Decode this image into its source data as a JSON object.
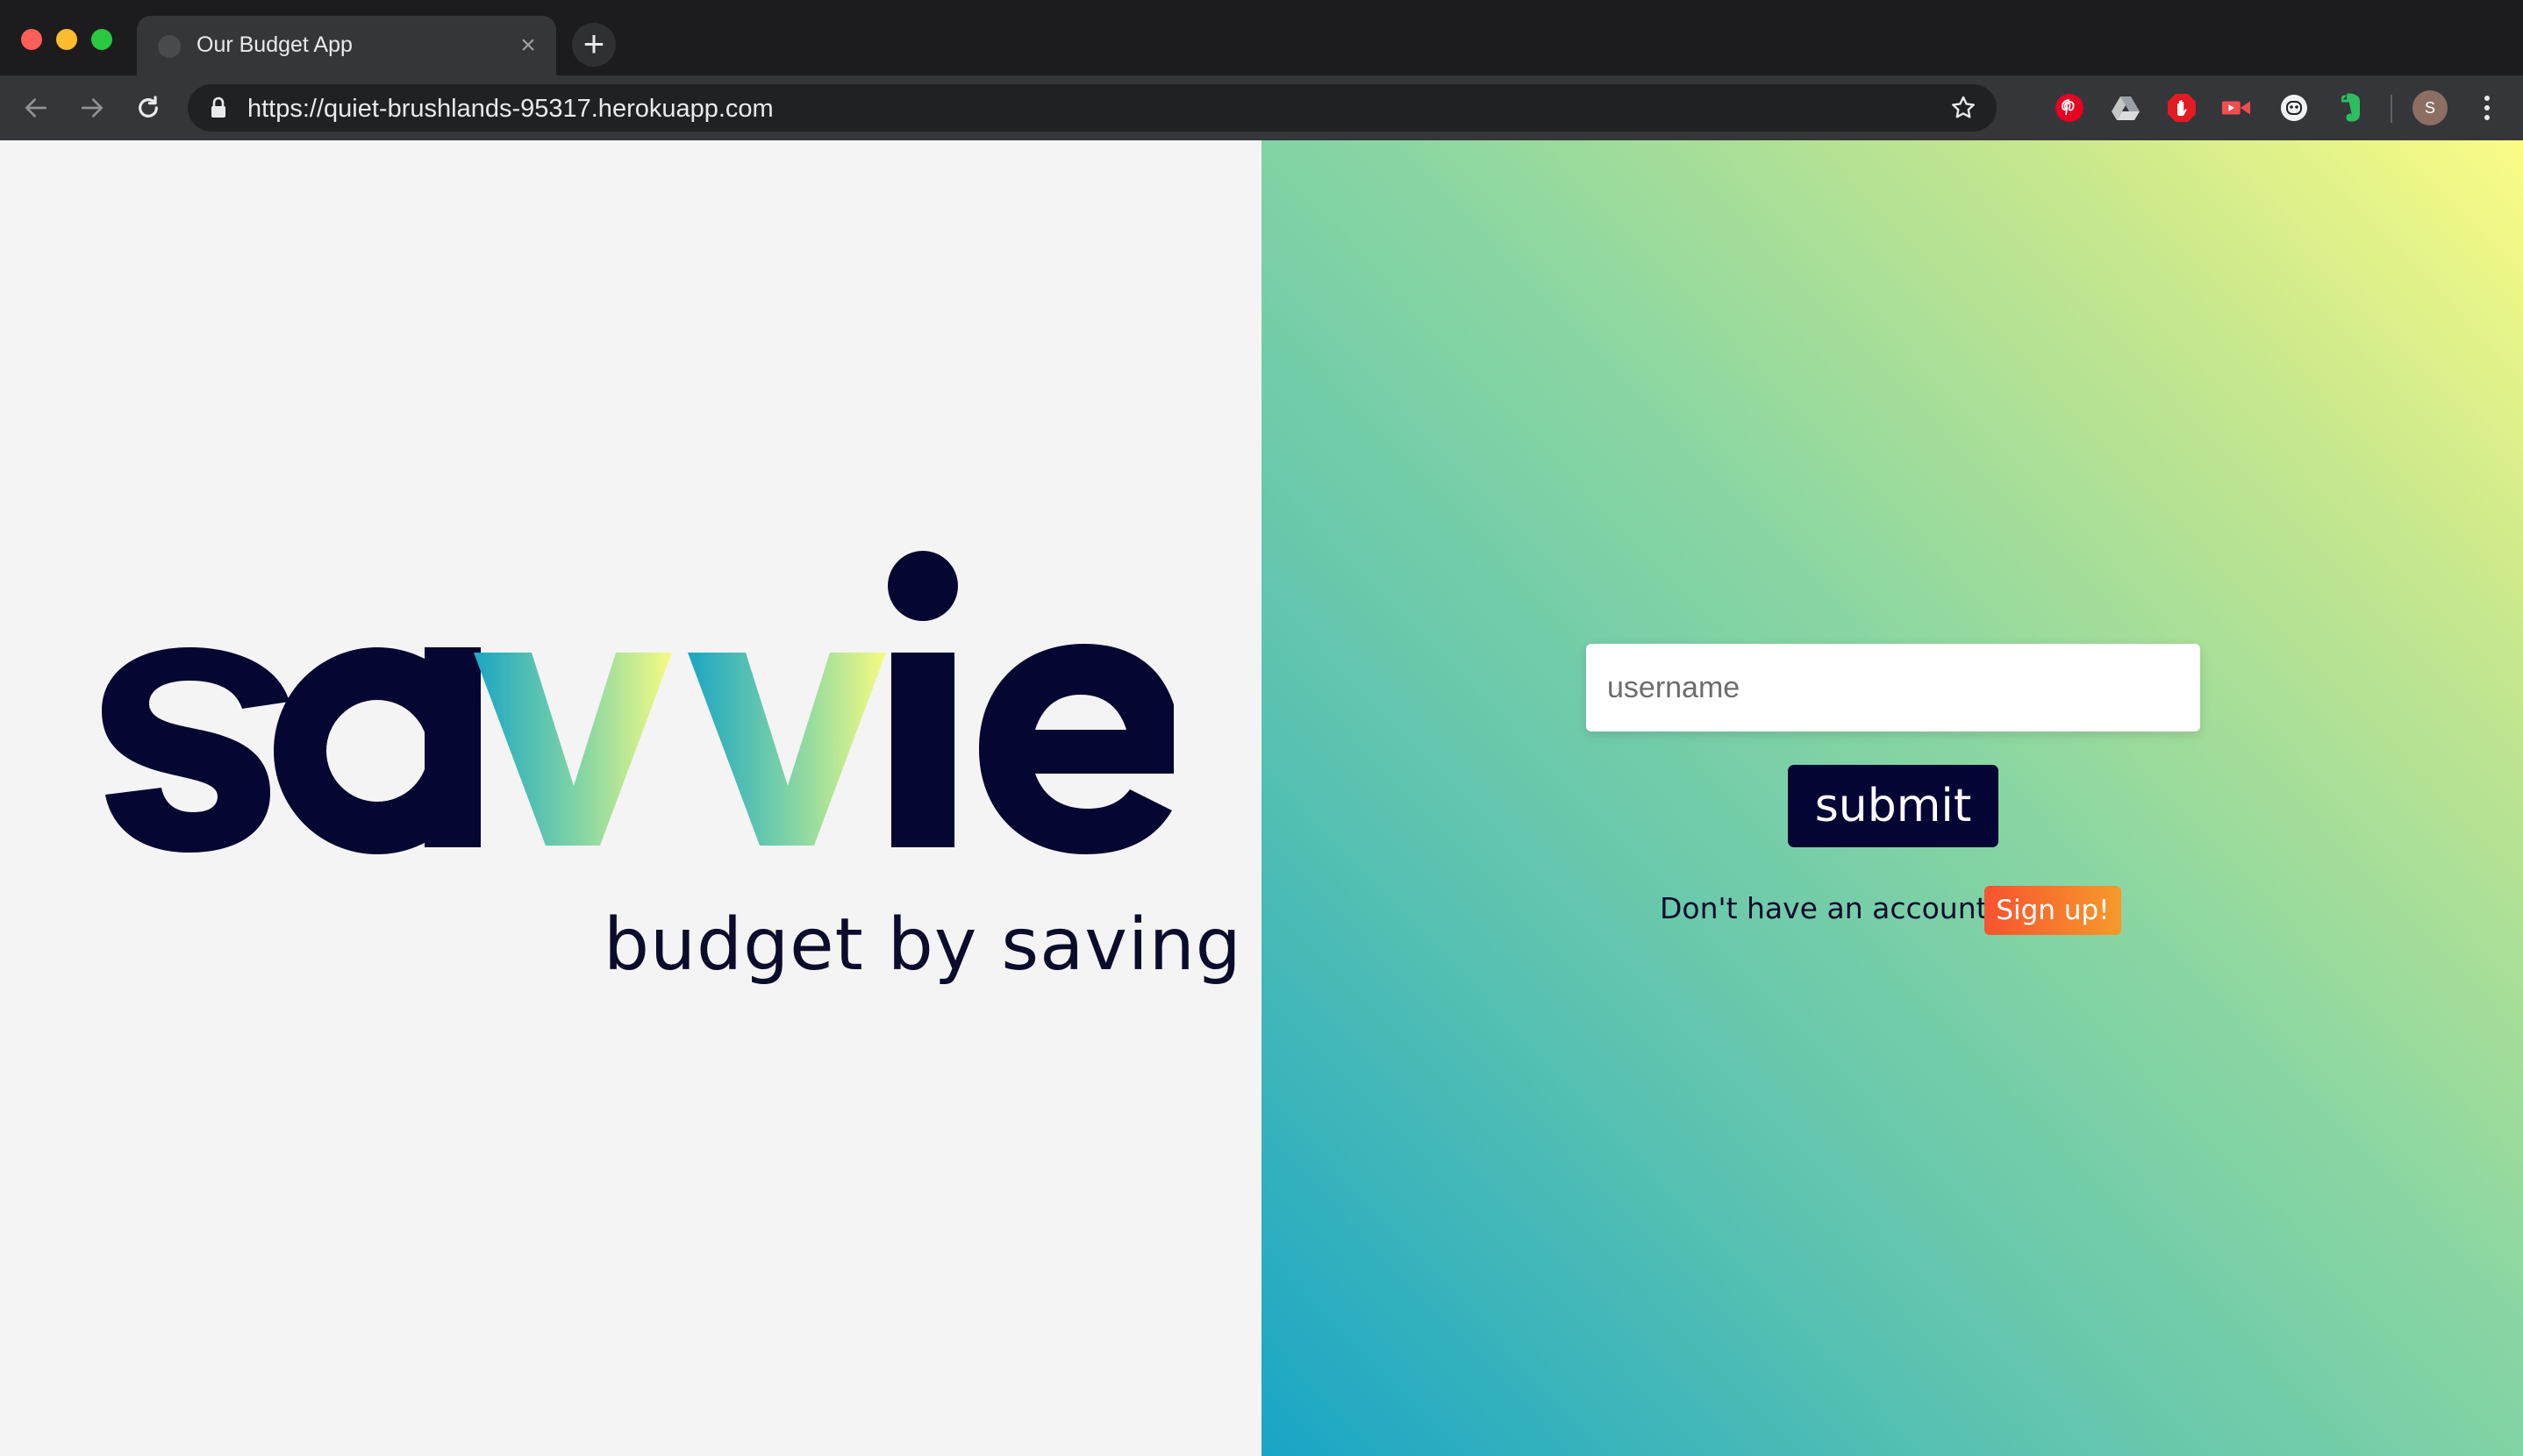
{
  "browser": {
    "tab_title": "Our Budget App",
    "url": "https://quiet-brushlands-95317.herokuapp.com",
    "avatar_initial": "S",
    "extensions": [
      "pinterest-icon",
      "google-drive-icon",
      "adblock-icon",
      "screencast-icon",
      "ghostery-icon",
      "evernote-icon"
    ]
  },
  "logo": {
    "wordmark": "savvie",
    "tagline": "budget by saving"
  },
  "login": {
    "username_placeholder": "username",
    "username_value": "",
    "submit_label": "submit",
    "signup_prompt": "Don't have an account?",
    "signup_label": "Sign up!"
  },
  "colors": {
    "brand_navy": "#050535",
    "gradient_teal": "#19a5c6",
    "gradient_yellow": "#fbfc86",
    "signup_orange_start": "#f7532f",
    "signup_orange_end": "#f69a2b",
    "left_panel_bg": "#f4f4f4"
  }
}
